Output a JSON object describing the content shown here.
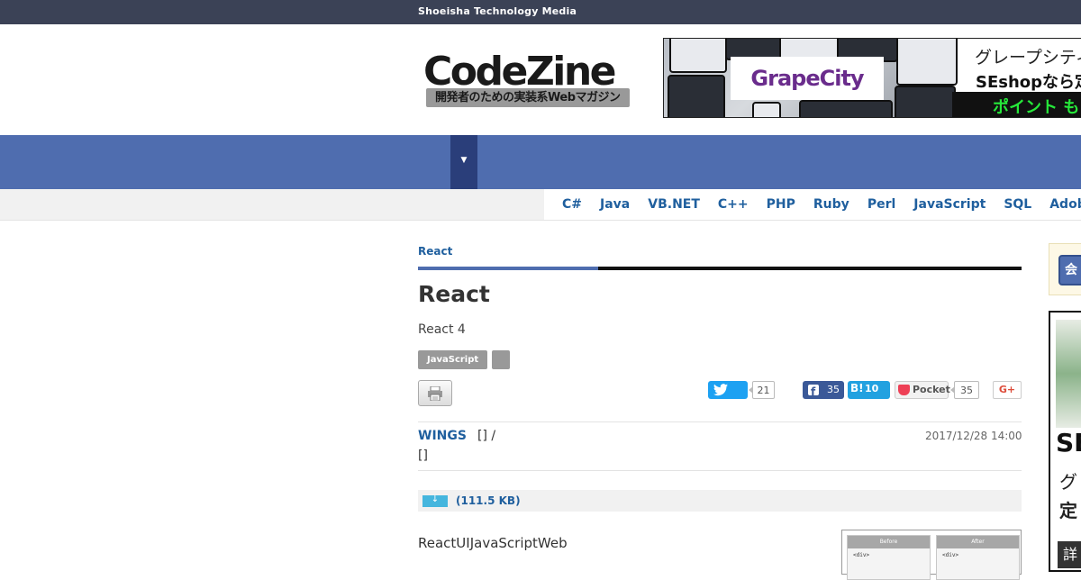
{
  "topbar": {
    "brand": "Shoeisha Technology Media"
  },
  "header": {
    "logo_text": "CodeZine",
    "logo_tagline": "開発者のための実装系Webマガジン",
    "banner": {
      "brand": "GrapeCity",
      "line1": "グレープシティ",
      "line2": "SEshopなら定価",
      "line3": "ポイント も"
    }
  },
  "nav": {
    "dropdown_icon": "triangle-down-icon",
    "dropdown_glyph": "▼"
  },
  "languages": [
    "C#",
    "Java",
    "VB.NET",
    "C++",
    "PHP",
    "Ruby",
    "Perl",
    "JavaScript",
    "SQL",
    "Adobe"
  ],
  "article": {
    "category": "React",
    "title": "React",
    "subtitle": "React 4",
    "tags": [
      "JavaScript",
      ""
    ],
    "share": {
      "twitter_count": "21",
      "facebook_count": "35",
      "hatena_label": "B!",
      "hatena_count": "10",
      "pocket_label": "Pocket",
      "pocket_count": "35",
      "gplus_label": "G+"
    },
    "author": "WINGS",
    "author_role": "[]   /",
    "author_extra": "[]",
    "date": "2017/12/28 14:00",
    "download_size": "(111.5 KB)",
    "download_glyph": "↓",
    "body_first": "ReactUIJavaScriptWeb",
    "figure": {
      "before_label": "Before",
      "after_label": "After",
      "before_code": "<div>",
      "after_code": "<div>"
    }
  },
  "sidebar": {
    "button_label": "会",
    "ad_line1": "SE",
    "ad_line2": "グ",
    "ad_line3": "定",
    "ad_line4": "詳"
  },
  "colors": {
    "topbar": "#3b4256",
    "nav_blue": "#4f6daf",
    "link_blue": "#1f5f9e",
    "twitter": "#1da1f2",
    "facebook": "#3b5998",
    "hatena": "#22a1e0"
  }
}
